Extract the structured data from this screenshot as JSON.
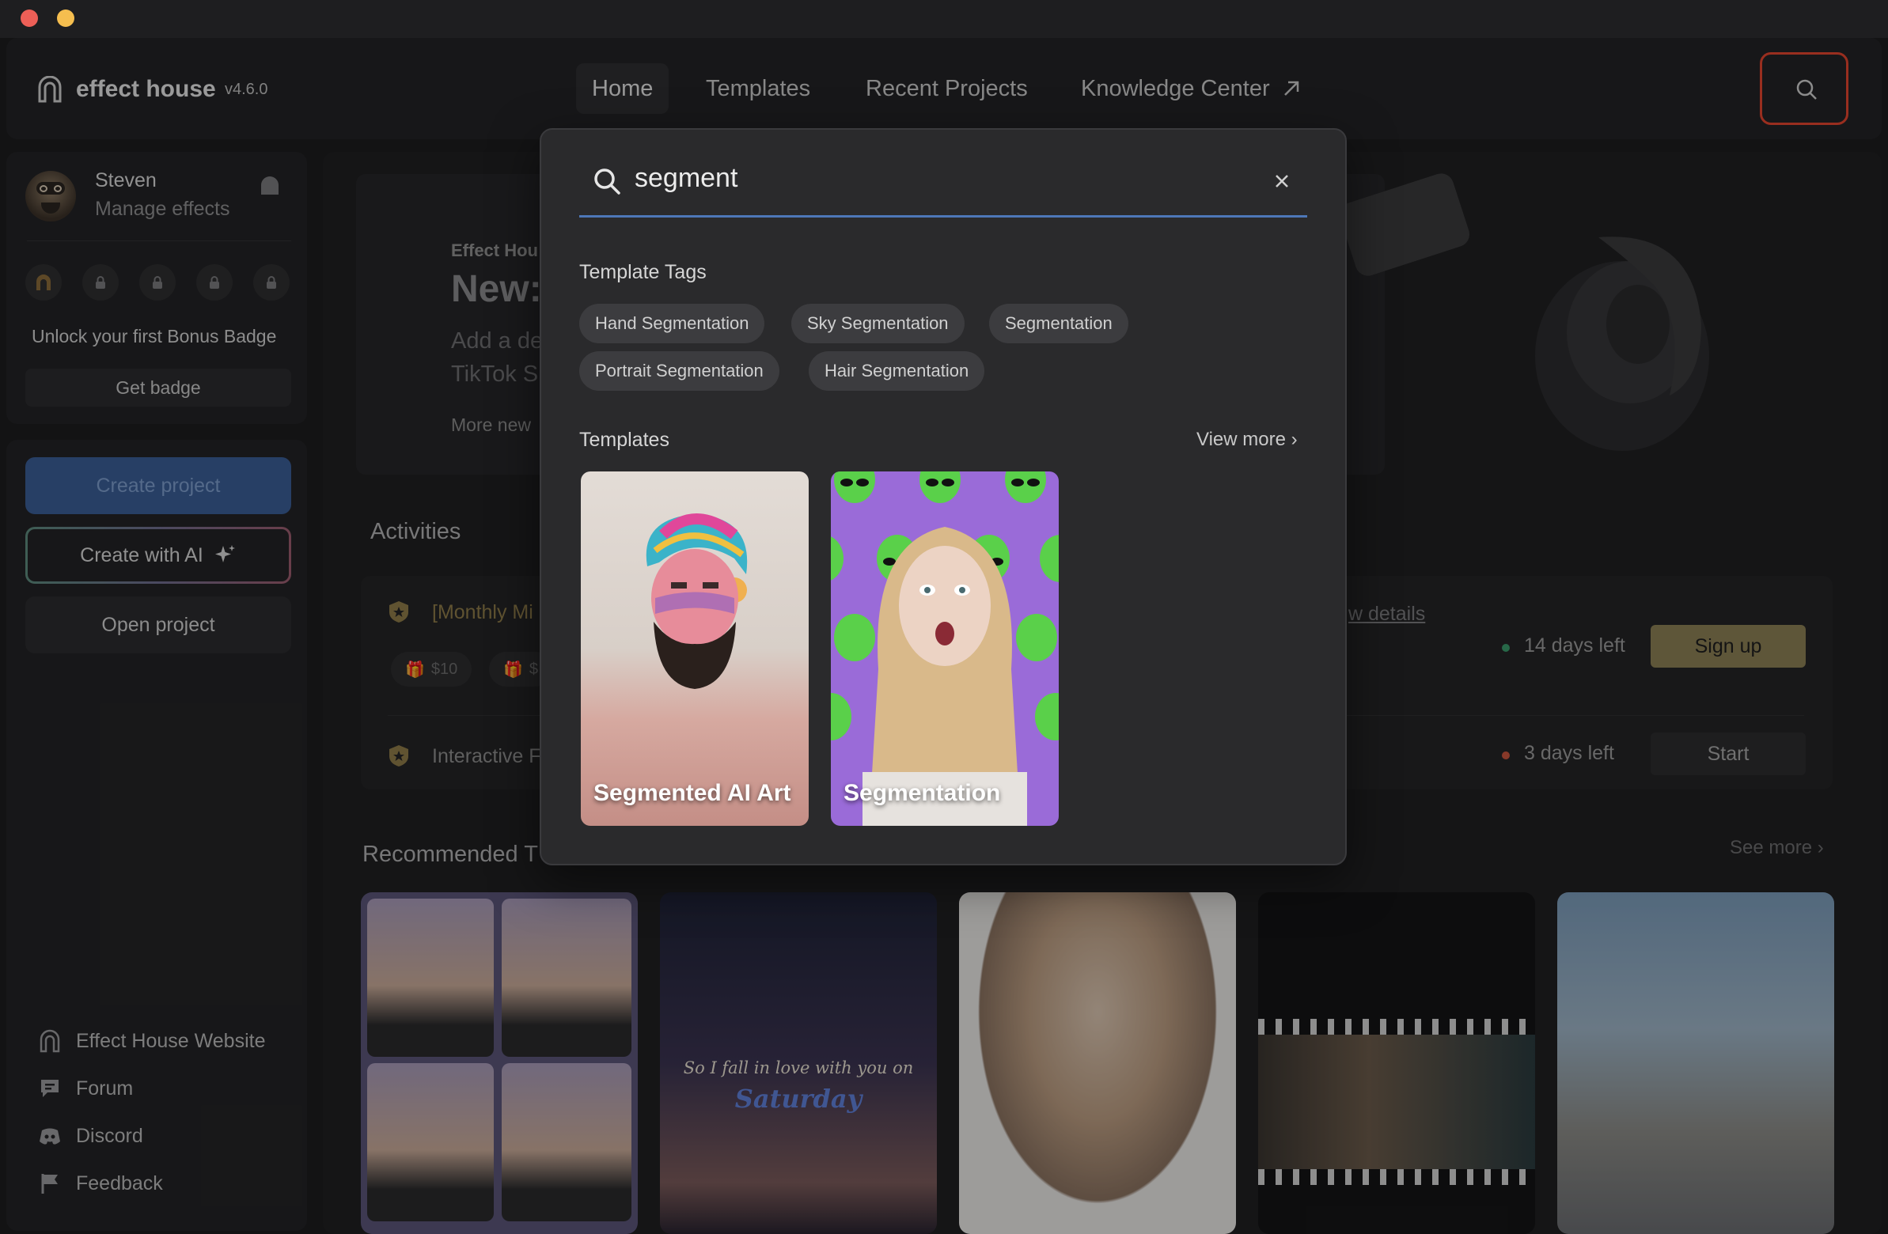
{
  "app": {
    "name": "effect house",
    "version": "v4.6.0"
  },
  "nav": {
    "items": [
      "Home",
      "Templates",
      "Recent Projects",
      "Knowledge Center"
    ]
  },
  "profile": {
    "name": "Steven",
    "manage_label": "Manage effects",
    "unlock_text": "Unlock your first Bonus Badge",
    "get_badge_label": "Get badge"
  },
  "actions": {
    "create_project": "Create project",
    "create_ai": "Create with AI",
    "open_project": "Open project"
  },
  "side_links": [
    "Effect House Website",
    "Forum",
    "Discord",
    "Feedback"
  ],
  "hero": {
    "tag": "Effect Hou",
    "title": "New:",
    "desc_line1": "Add a de",
    "desc_line2": "TikTok S",
    "more": "More new"
  },
  "activities": {
    "title": "Activities",
    "row1_title": "[Monthly Mi",
    "gift1": "$10",
    "gift2": "$",
    "details": "w details",
    "row1_days": "14 days left",
    "signup": "Sign up",
    "row2_title": "Interactive F",
    "row2_days": "3 days left",
    "start": "Start"
  },
  "recommended": {
    "title": "Recommended T",
    "see_more": "See more",
    "card2_line1": "So I fall in love with you on",
    "card2_line2": "Saturday"
  },
  "search": {
    "value": "segment",
    "tags_label": "Template Tags",
    "tags_row1": [
      "Hand Segmentation",
      "Sky Segmentation",
      "Segmentation"
    ],
    "tags_row2": [
      "Portrait Segmentation",
      "Hair Segmentation"
    ],
    "templates_label": "Templates",
    "view_more": "View more",
    "templates": [
      "Segmented AI Art",
      "Segmentation"
    ]
  },
  "colors": {
    "accent_blue": "#3a5d95",
    "search_highlight": "#e2452f",
    "signup": "#8b7f55",
    "status_green": "#3a9a6a",
    "status_red": "#c8553d"
  }
}
